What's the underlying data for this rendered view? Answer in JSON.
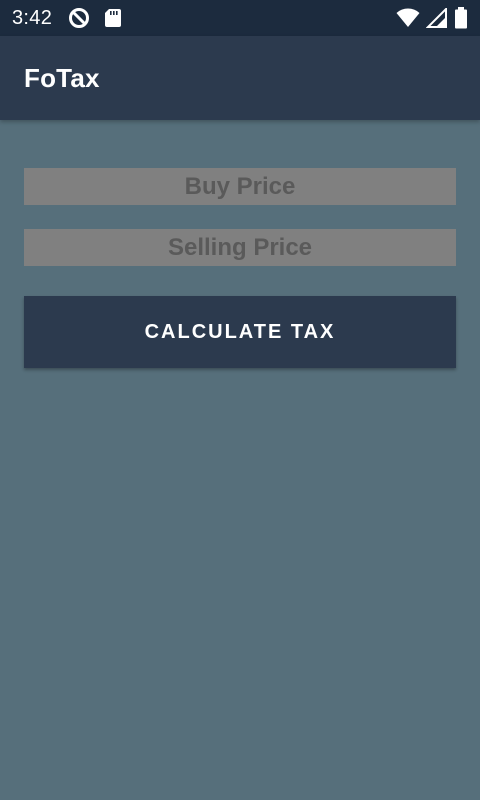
{
  "status_bar": {
    "time": "3:42",
    "left_icons": [
      "do-not-disturb-icon",
      "sd-card-icon"
    ],
    "right_icons": [
      "wifi-icon",
      "cell-signal-icon",
      "battery-icon"
    ]
  },
  "app_bar": {
    "title": "FoTax"
  },
  "form": {
    "buy_price": {
      "value": "",
      "placeholder": "Buy Price"
    },
    "selling_price": {
      "value": "",
      "placeholder": "Selling Price"
    },
    "calculate_label": "CALCULATE TAX"
  },
  "colors": {
    "status_bar": "#1c2b3e",
    "app_bar": "#2c3a4e",
    "background": "#566f7b",
    "field_background": "#808080",
    "field_text": "#5a5a5a",
    "button": "#2c3a4e"
  }
}
